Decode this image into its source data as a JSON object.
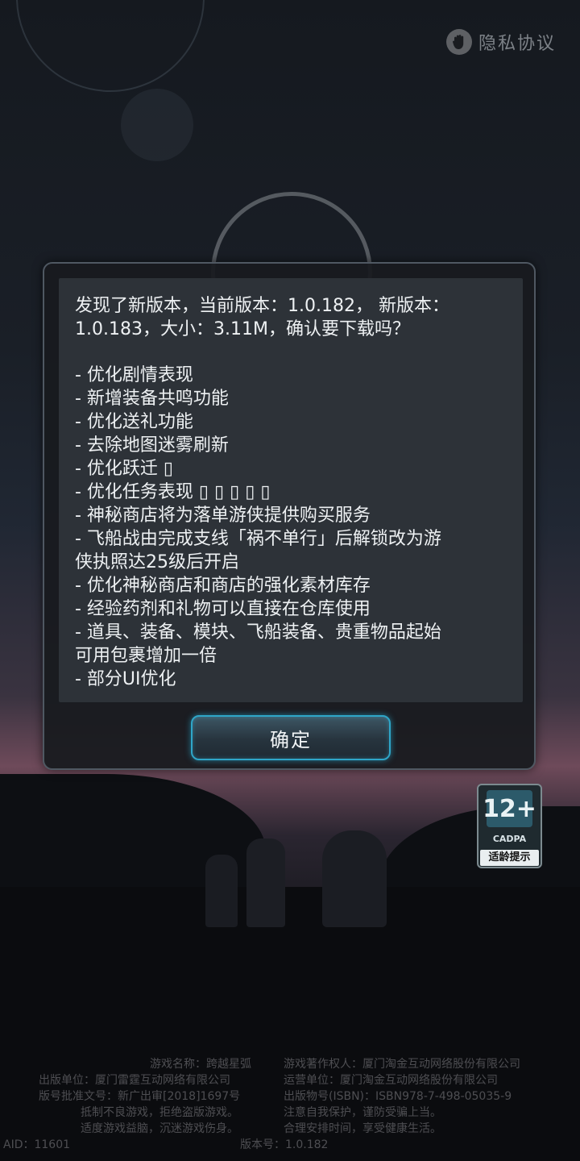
{
  "header": {
    "privacy_label": "隐私协议",
    "privacy_icon": "hand-icon"
  },
  "dialog": {
    "message_lines": [
      "发现了新版本，当前版本：1.0.182， 新版本：",
      "1.0.183，大小：3.11M，确认要下载吗？"
    ],
    "changelog": [
      "- 优化剧情表现",
      "- 新增装备共鸣功能",
      "- 优化送礼功能",
      "- 去除地图迷雾刷新",
      "- 优化跃迁 ▯",
      "- 优化任务表现 ▯ ▯ ▯ ▯ ▯",
      "- 神秘商店将为落单游侠提供购买服务",
      "- 飞船战由完成支线「祸不单行」后解锁改为游",
      "侠执照达25级后开启",
      "- 优化神秘商店和商店的强化素材库存",
      "- 经验药剂和礼物可以直接在仓库使用",
      "- 道具、装备、模块、飞船装备、贵重物品起始",
      "可用包裹增加一倍",
      "- 部分UI优化"
    ],
    "confirm_label": "确定"
  },
  "age_rating": {
    "number": "12+",
    "org": "CADPA",
    "tip": "适龄提示"
  },
  "footer": {
    "game_name": "游戏名称：跨越星弧",
    "copyright_owner": "游戏著作权人：厦门淘金互动网络股份有限公司",
    "publisher": "出版单位：厦门雷霆互动网络有限公司",
    "operator": "运营单位：厦门淘金互动网络股份有限公司",
    "approval_no": "版号批准文号：新广出审[2018]1697号",
    "isbn": "出版物号(ISBN)：ISBN978-7-498-05035-9",
    "health_1a": "抵制不良游戏，拒绝盗版游戏。",
    "health_1b": "注意自我保护，谨防受骗上当。",
    "health_2a": "适度游戏益脑，沉迷游戏伤身。",
    "health_2b": "合理安排时间，享受健康生活。",
    "aid": "AID：11601",
    "version": "版本号：1.0.182"
  }
}
